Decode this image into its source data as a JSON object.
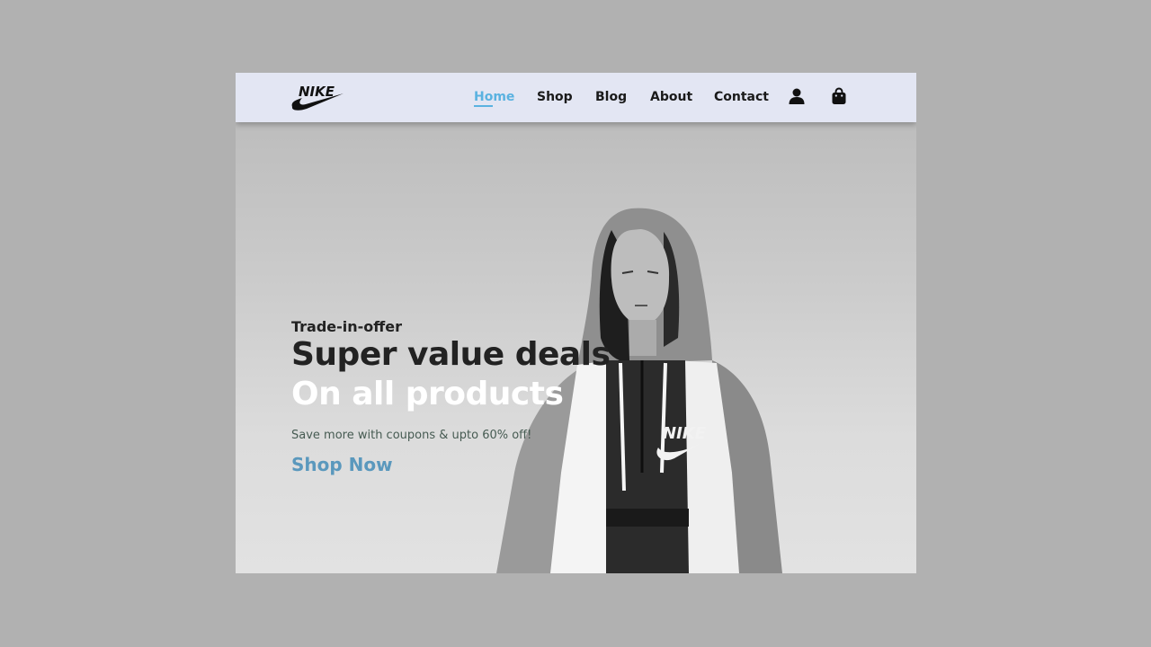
{
  "brand": {
    "name": "NIKE",
    "logo_icon": "nike-swoosh-logo"
  },
  "nav": {
    "items": [
      {
        "label": "Home",
        "active": true
      },
      {
        "label": "Shop",
        "active": false
      },
      {
        "label": "Blog",
        "active": false
      },
      {
        "label": "About",
        "active": false
      },
      {
        "label": "Contact",
        "active": false
      }
    ],
    "icons": [
      "user-icon",
      "shopping-bag-icon"
    ]
  },
  "hero": {
    "tagline": "Trade-in-offer",
    "headline": "Super value deals",
    "subheadline": "On all products",
    "description": "Save more with coupons & upto 60% off!",
    "cta_label": "Shop Now",
    "image_subject": "model in grey hoodie"
  },
  "colors": {
    "background": "#b1b1b1",
    "header_bg": "#e3e6f3",
    "active_link": "#5ab2e0",
    "cta": "#5a98bd",
    "headline": "#222222",
    "subheadline": "#ffffff",
    "description": "#465b52"
  }
}
